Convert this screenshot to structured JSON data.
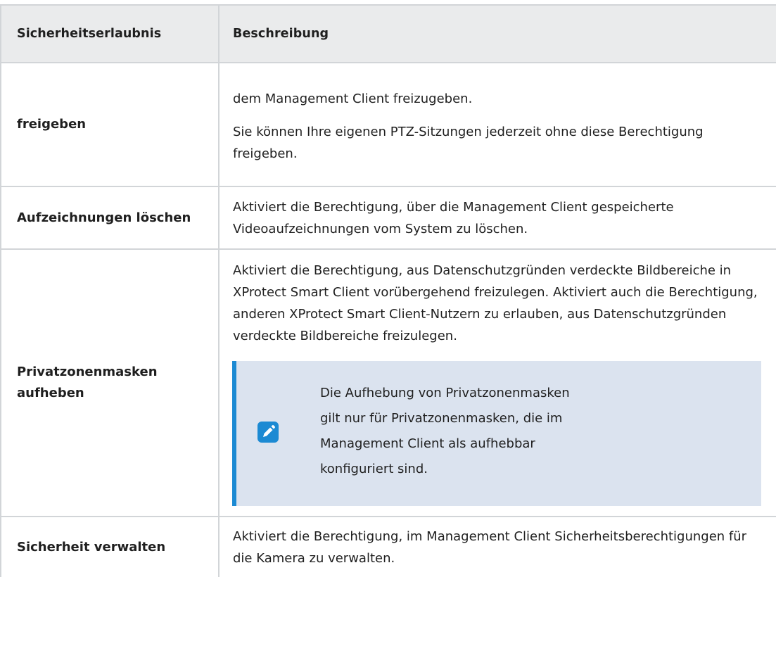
{
  "table": {
    "headers": {
      "permission": "Sicherheitserlaubnis",
      "description": "Beschreibung"
    },
    "rows": [
      {
        "permission": "freigeben",
        "paragraphs": [
          "dem Management Client freizugeben.",
          "Sie können Ihre eigenen PTZ-Sitzungen jederzeit ohne diese Berechtigung freigeben."
        ]
      },
      {
        "permission": "Aufzeichnungen löschen",
        "paragraphs": [
          "Aktiviert die Berechtigung, über die Management Client gespeicherte Videoaufzeichnungen vom System zu löschen."
        ]
      },
      {
        "permission": "Privatzonenmasken aufheben",
        "paragraphs": [
          "Aktiviert die Berechtigung, aus Datenschutzgründen verdeckte Bildbereiche in XProtect Smart Client vorübergehend freizulegen. Aktiviert auch die Berechtigung, anderen XProtect Smart Client-Nutzern zu erlauben, aus Datenschutzgründen verdeckte Bildbereiche freizulegen."
        ],
        "note": {
          "icon": "pencil-note-icon",
          "text": "Die Aufhebung von Privatzonenmasken gilt nur für Privatzonenmasken, die im Management Client als aufhebbar konfiguriert sind."
        }
      },
      {
        "permission": "Sicherheit verwalten",
        "paragraphs": [
          "Aktiviert die Berechtigung, im Management Client Sicherheitsberechtigungen für die Kamera zu verwalten."
        ]
      }
    ]
  },
  "colors": {
    "header_bg": "#eaebec",
    "border": "#d2d5d8",
    "note_bg": "#dbe3ef",
    "accent": "#1c8ad3"
  }
}
